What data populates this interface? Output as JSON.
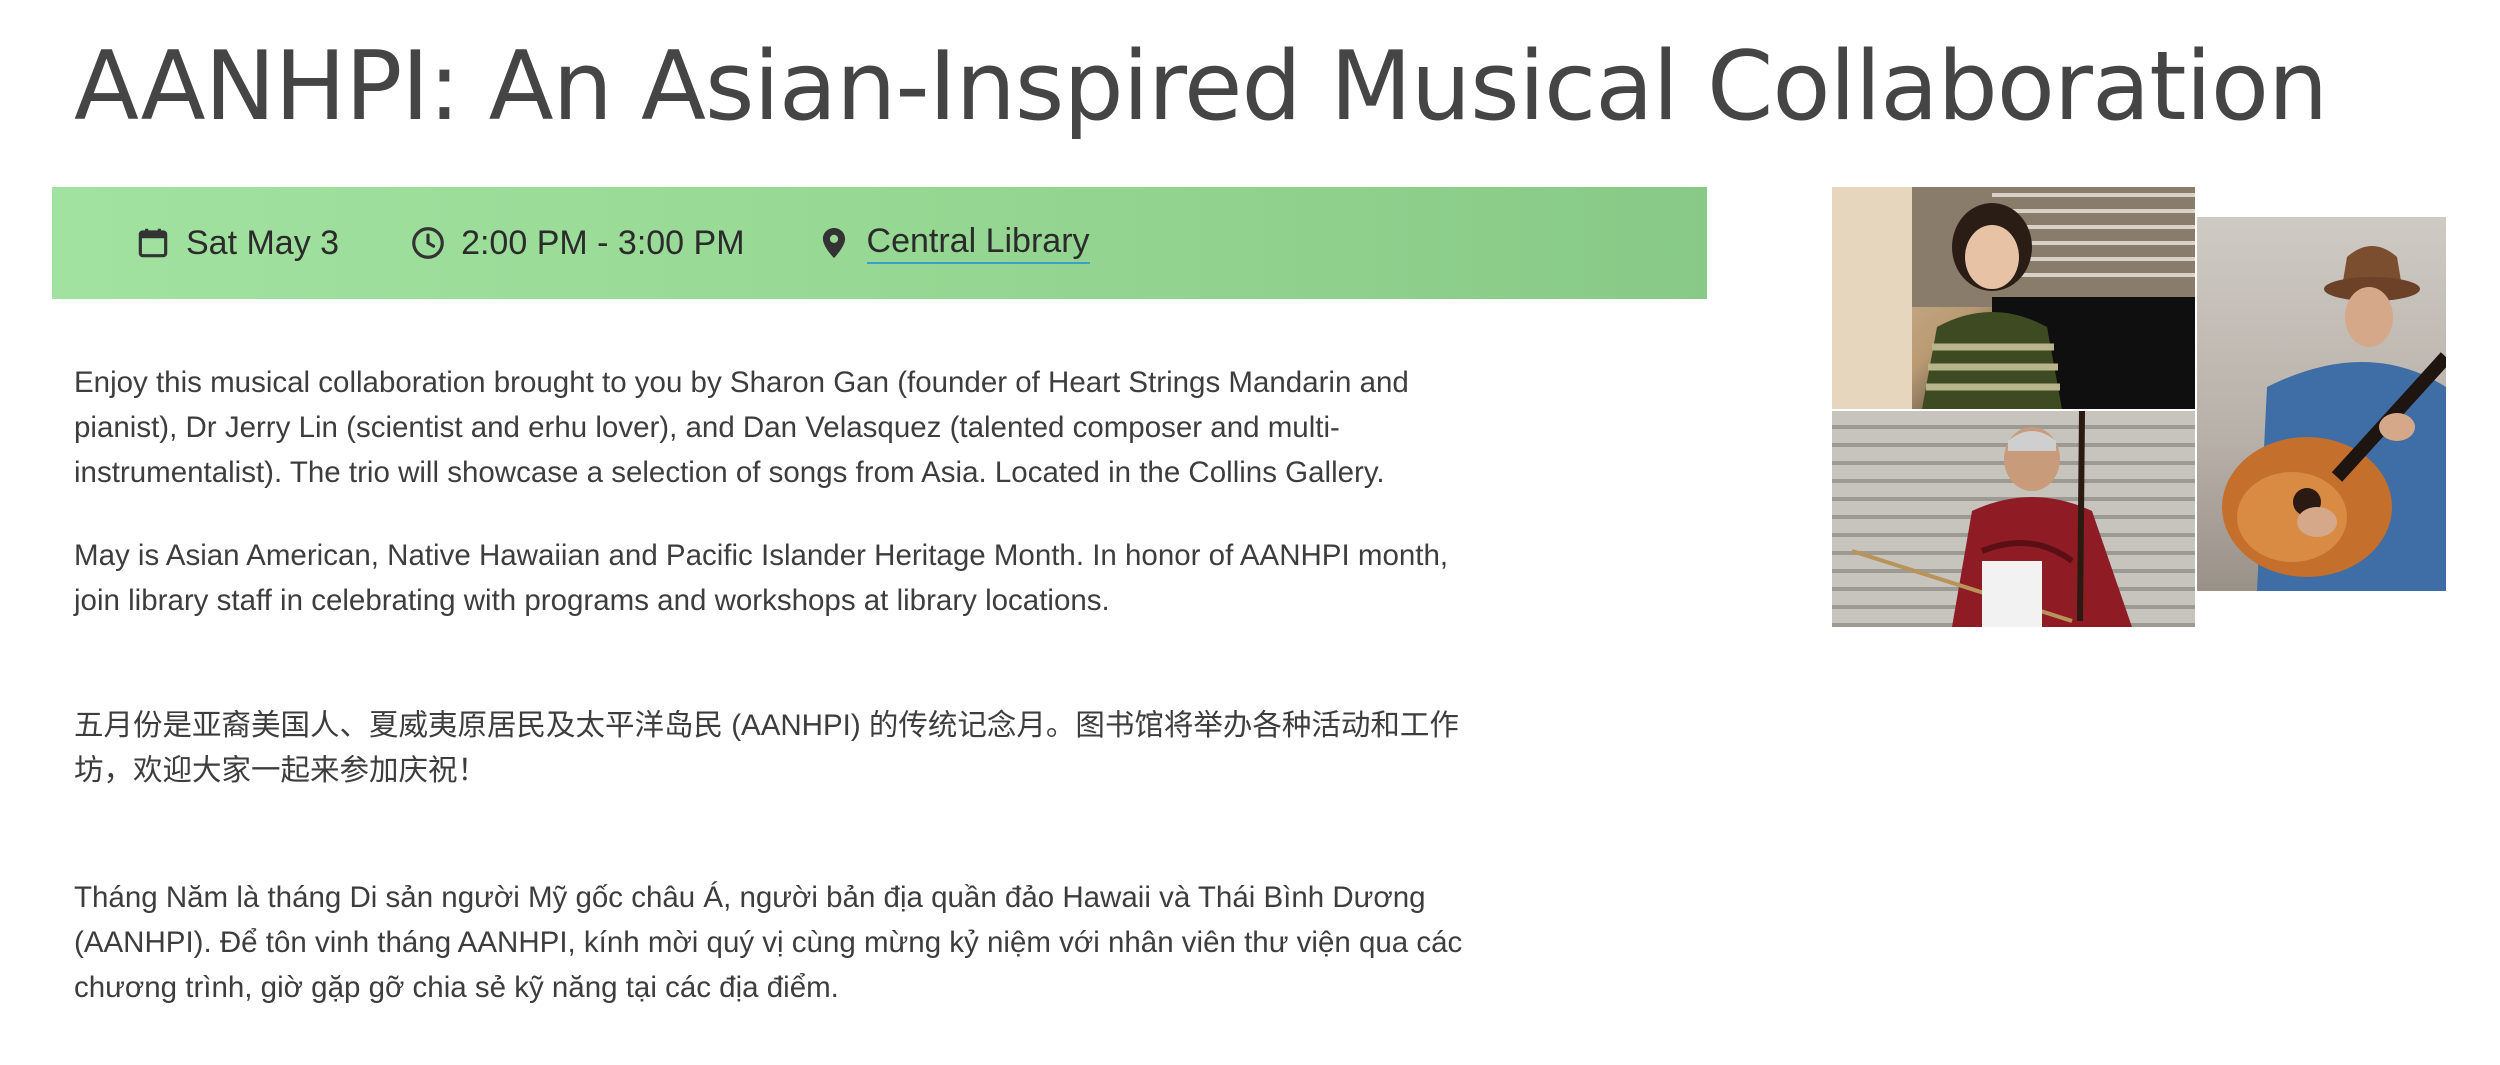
{
  "event": {
    "title": "AANHPI: An Asian-Inspired Musical Collaboration",
    "date": "Sat May 3",
    "time": "2:00 PM - 3:00 PM",
    "location": "Central Library"
  },
  "description": {
    "paragraph1": "Enjoy this musical collaboration brought to you by Sharon Gan (founder of Heart Strings Mandarin and pianist), Dr Jerry Lin (scientist and erhu lover), and Dan Velasquez (talented composer and multi-instrumentalist). The trio will showcase a selection of songs from Asia. Located in the Collins Gallery.",
    "paragraph2": "May is Asian American, Native Hawaiian and Pacific Islander Heritage Month. In honor of AANHPI month, join library staff in celebrating with programs and workshops at library locations.",
    "paragraph3": "五月份是亚裔美国人、夏威夷原居民及太平洋岛民 (AANHPI) 的传统记念月。图书馆将举办各种活动和工作坊，欢迎大家一起来参加庆祝！",
    "paragraph4": "Tháng Năm là tháng Di sản người Mỹ gốc châu Á, người bản địa quần đảo Hawaii và Thái Bình Dương (AANHPI). Để tôn vinh tháng AANHPI, kính mời quý vị cùng mừng kỷ niệm với nhân viên thư viện qua các chương trình, giờ gặp gỡ chia sẻ kỹ năng tại các địa điểm."
  },
  "icons": {
    "date": "calendar-icon",
    "time": "clock-icon",
    "location": "map-pin-icon"
  },
  "colors": {
    "banner_start": "#a2e2a1",
    "banner_end": "#88c987",
    "link_underline": "#3aa0c8"
  }
}
